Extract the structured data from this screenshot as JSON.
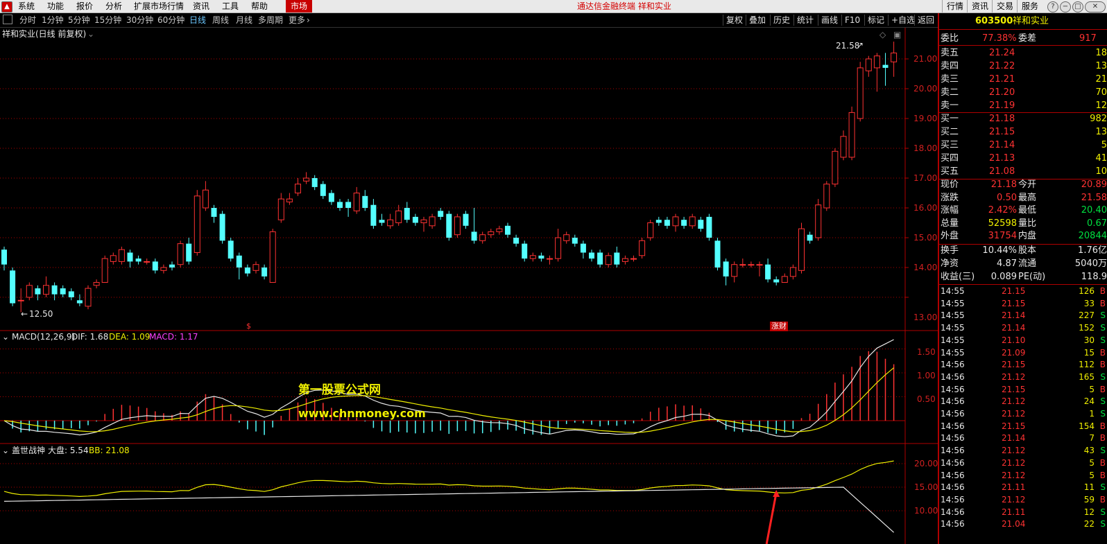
{
  "menu": {
    "items": [
      "系统",
      "功能",
      "报价",
      "分析",
      "扩展市场行情",
      "资讯",
      "工具",
      "帮助"
    ],
    "market_tab": "市场",
    "app_title": "通达信金融终端  祥和实业",
    "right_items": [
      "行情",
      "资讯",
      "交易",
      "服务"
    ]
  },
  "toolbar": {
    "periods": [
      "分时",
      "1分钟",
      "5分钟",
      "15分钟",
      "30分钟",
      "60分钟",
      "日线",
      "周线",
      "月线",
      "多周期",
      "更多"
    ],
    "active_period": "日线",
    "tools": [
      "复权",
      "叠加",
      "历史",
      "统计",
      "画线",
      "F10",
      "标记",
      "+自选",
      "返回"
    ]
  },
  "chart": {
    "main_title": "祥和实业(日线 前复权)",
    "high_label": "21.58",
    "low_label": "12.50",
    "price_axis": [
      "21.00",
      "20.00",
      "19.00",
      "18.00",
      "17.00",
      "16.00",
      "15.00",
      "14.00",
      "13.00"
    ],
    "event_markers": [
      "$",
      "涨财"
    ],
    "candles": [
      {
        "o": 14.6,
        "c": 14.1,
        "h": 14.7,
        "l": 13.9
      },
      {
        "o": 13.9,
        "c": 12.8,
        "h": 14.0,
        "l": 12.7
      },
      {
        "o": 12.9,
        "c": 12.9,
        "h": 13.3,
        "l": 12.5
      },
      {
        "o": 13.0,
        "c": 13.4,
        "h": 13.5,
        "l": 12.9
      },
      {
        "o": 13.3,
        "c": 13.1,
        "h": 13.4,
        "l": 12.9
      },
      {
        "o": 13.1,
        "c": 13.4,
        "h": 13.7,
        "l": 13.0
      },
      {
        "o": 13.4,
        "c": 13.1,
        "h": 13.5,
        "l": 12.9
      },
      {
        "o": 13.3,
        "c": 13.1,
        "h": 13.4,
        "l": 13.0
      },
      {
        "o": 13.2,
        "c": 13.0,
        "h": 13.3,
        "l": 12.9
      },
      {
        "o": 12.9,
        "c": 12.8,
        "h": 13.1,
        "l": 12.7
      },
      {
        "o": 12.7,
        "c": 13.3,
        "h": 13.4,
        "l": 12.6
      },
      {
        "o": 13.4,
        "c": 13.5,
        "h": 13.6,
        "l": 13.3
      },
      {
        "o": 13.5,
        "c": 14.3,
        "h": 14.4,
        "l": 13.5
      },
      {
        "o": 14.2,
        "c": 14.4,
        "h": 14.5,
        "l": 14.1
      },
      {
        "o": 14.2,
        "c": 14.6,
        "h": 14.7,
        "l": 14.1
      },
      {
        "o": 14.5,
        "c": 14.2,
        "h": 14.6,
        "l": 14.0
      },
      {
        "o": 14.3,
        "c": 14.2,
        "h": 14.4,
        "l": 14.1
      },
      {
        "o": 14.2,
        "c": 14.2,
        "h": 14.3,
        "l": 14.1
      },
      {
        "o": 14.2,
        "c": 13.9,
        "h": 14.3,
        "l": 13.8
      },
      {
        "o": 13.9,
        "c": 14.0,
        "h": 14.1,
        "l": 13.8
      },
      {
        "o": 14.1,
        "c": 14.0,
        "h": 14.2,
        "l": 13.9
      },
      {
        "o": 14.1,
        "c": 14.8,
        "h": 14.9,
        "l": 14.0
      },
      {
        "o": 14.8,
        "c": 14.2,
        "h": 15.0,
        "l": 14.1
      },
      {
        "o": 14.5,
        "c": 16.4,
        "h": 16.6,
        "l": 14.4
      },
      {
        "o": 16.0,
        "c": 16.6,
        "h": 16.9,
        "l": 15.9
      },
      {
        "o": 16.0,
        "c": 15.7,
        "h": 16.1,
        "l": 15.5
      },
      {
        "o": 15.8,
        "c": 14.9,
        "h": 15.9,
        "l": 14.8
      },
      {
        "o": 14.9,
        "c": 14.3,
        "h": 15.0,
        "l": 14.2
      },
      {
        "o": 14.4,
        "c": 14.0,
        "h": 14.5,
        "l": 13.6
      },
      {
        "o": 14.0,
        "c": 13.8,
        "h": 14.1,
        "l": 13.7
      },
      {
        "o": 13.9,
        "c": 14.1,
        "h": 14.2,
        "l": 13.8
      },
      {
        "o": 14.0,
        "c": 13.7,
        "h": 14.1,
        "l": 13.6
      },
      {
        "o": 13.5,
        "c": 15.2,
        "h": 15.3,
        "l": 13.5
      },
      {
        "o": 15.6,
        "c": 16.3,
        "h": 16.5,
        "l": 15.5
      },
      {
        "o": 16.2,
        "c": 16.3,
        "h": 16.5,
        "l": 16.1
      },
      {
        "o": 16.5,
        "c": 16.8,
        "h": 17.0,
        "l": 16.4
      },
      {
        "o": 16.9,
        "c": 17.0,
        "h": 17.2,
        "l": 16.8
      },
      {
        "o": 17.0,
        "c": 16.7,
        "h": 17.1,
        "l": 16.6
      },
      {
        "o": 16.8,
        "c": 16.4,
        "h": 16.9,
        "l": 16.3
      },
      {
        "o": 16.5,
        "c": 16.2,
        "h": 16.6,
        "l": 16.1
      },
      {
        "o": 16.2,
        "c": 16.0,
        "h": 16.3,
        "l": 15.9
      },
      {
        "o": 16.2,
        "c": 16.0,
        "h": 16.3,
        "l": 15.7
      },
      {
        "o": 15.9,
        "c": 16.5,
        "h": 16.7,
        "l": 15.8
      },
      {
        "o": 16.4,
        "c": 16.0,
        "h": 16.6,
        "l": 15.9
      },
      {
        "o": 16.1,
        "c": 15.4,
        "h": 16.3,
        "l": 15.3
      },
      {
        "o": 15.6,
        "c": 15.5,
        "h": 15.8,
        "l": 15.4
      },
      {
        "o": 15.4,
        "c": 15.6,
        "h": 15.8,
        "l": 15.3
      },
      {
        "o": 15.5,
        "c": 15.9,
        "h": 16.1,
        "l": 15.4
      },
      {
        "o": 16.0,
        "c": 15.6,
        "h": 16.2,
        "l": 15.5
      },
      {
        "o": 15.7,
        "c": 15.5,
        "h": 15.8,
        "l": 15.4
      },
      {
        "o": 15.5,
        "c": 15.6,
        "h": 15.7,
        "l": 15.2
      },
      {
        "o": 15.4,
        "c": 15.7,
        "h": 15.8,
        "l": 15.3
      },
      {
        "o": 15.9,
        "c": 15.7,
        "h": 16.0,
        "l": 15.6
      },
      {
        "o": 15.8,
        "c": 15.0,
        "h": 15.9,
        "l": 14.9
      },
      {
        "o": 15.1,
        "c": 15.7,
        "h": 15.8,
        "l": 15.0
      },
      {
        "o": 15.8,
        "c": 15.4,
        "h": 15.9,
        "l": 15.3
      },
      {
        "o": 15.2,
        "c": 14.9,
        "h": 16.0,
        "l": 14.8
      },
      {
        "o": 14.9,
        "c": 15.1,
        "h": 15.2,
        "l": 14.8
      },
      {
        "o": 15.1,
        "c": 15.2,
        "h": 15.3,
        "l": 15.0
      },
      {
        "o": 15.2,
        "c": 15.3,
        "h": 15.4,
        "l": 15.1
      },
      {
        "o": 15.4,
        "c": 15.1,
        "h": 15.5,
        "l": 15.0
      },
      {
        "o": 15.0,
        "c": 14.8,
        "h": 15.1,
        "l": 14.7
      },
      {
        "o": 14.8,
        "c": 14.3,
        "h": 14.9,
        "l": 14.2
      },
      {
        "o": 14.3,
        "c": 14.4,
        "h": 14.5,
        "l": 14.2
      },
      {
        "o": 14.4,
        "c": 14.3,
        "h": 14.5,
        "l": 14.2
      },
      {
        "o": 14.3,
        "c": 14.3,
        "h": 14.4,
        "l": 14.1
      },
      {
        "o": 14.3,
        "c": 15.0,
        "h": 15.3,
        "l": 14.2
      },
      {
        "o": 14.9,
        "c": 15.1,
        "h": 15.2,
        "l": 14.8
      },
      {
        "o": 15.0,
        "c": 14.8,
        "h": 15.1,
        "l": 14.7
      },
      {
        "o": 14.8,
        "c": 14.5,
        "h": 14.9,
        "l": 14.3
      },
      {
        "o": 14.5,
        "c": 14.3,
        "h": 14.6,
        "l": 14.2
      },
      {
        "o": 14.5,
        "c": 14.1,
        "h": 14.6,
        "l": 14.0
      },
      {
        "o": 14.1,
        "c": 14.4,
        "h": 14.5,
        "l": 14.0
      },
      {
        "o": 14.5,
        "c": 14.1,
        "h": 14.7,
        "l": 14.0
      },
      {
        "o": 14.2,
        "c": 14.3,
        "h": 14.4,
        "l": 14.1
      },
      {
        "o": 14.3,
        "c": 14.3,
        "h": 14.4,
        "l": 14.2
      },
      {
        "o": 14.4,
        "c": 14.9,
        "h": 15.0,
        "l": 14.3
      },
      {
        "o": 15.0,
        "c": 15.5,
        "h": 15.6,
        "l": 14.9
      },
      {
        "o": 15.6,
        "c": 15.5,
        "h": 15.7,
        "l": 15.4
      },
      {
        "o": 15.6,
        "c": 15.4,
        "h": 15.7,
        "l": 15.3
      },
      {
        "o": 15.4,
        "c": 15.7,
        "h": 15.8,
        "l": 15.2
      },
      {
        "o": 15.6,
        "c": 15.4,
        "h": 15.7,
        "l": 15.3
      },
      {
        "o": 15.4,
        "c": 15.7,
        "h": 15.8,
        "l": 15.3
      },
      {
        "o": 15.6,
        "c": 15.3,
        "h": 15.7,
        "l": 15.2
      },
      {
        "o": 15.7,
        "c": 15.0,
        "h": 15.8,
        "l": 14.9
      },
      {
        "o": 14.9,
        "c": 14.0,
        "h": 15.0,
        "l": 13.9
      },
      {
        "o": 14.2,
        "c": 13.7,
        "h": 14.3,
        "l": 13.4
      },
      {
        "o": 13.7,
        "c": 14.1,
        "h": 14.2,
        "l": 13.5
      },
      {
        "o": 14.1,
        "c": 14.1,
        "h": 14.3,
        "l": 14.0
      },
      {
        "o": 14.1,
        "c": 14.1,
        "h": 14.2,
        "l": 14.0
      },
      {
        "o": 14.1,
        "c": 14.1,
        "h": 14.2,
        "l": 13.7
      },
      {
        "o": 14.1,
        "c": 13.6,
        "h": 14.3,
        "l": 13.5
      },
      {
        "o": 13.6,
        "c": 13.5,
        "h": 13.7,
        "l": 13.4
      },
      {
        "o": 13.5,
        "c": 13.7,
        "h": 13.8,
        "l": 13.5
      },
      {
        "o": 13.7,
        "c": 14.0,
        "h": 14.1,
        "l": 13.6
      },
      {
        "o": 13.9,
        "c": 15.3,
        "h": 15.5,
        "l": 13.8
      },
      {
        "o": 15.1,
        "c": 14.9,
        "h": 15.2,
        "l": 14.8
      },
      {
        "o": 15.0,
        "c": 16.1,
        "h": 16.3,
        "l": 14.9
      },
      {
        "o": 16.0,
        "c": 16.8,
        "h": 16.9,
        "l": 15.9
      },
      {
        "o": 16.8,
        "c": 17.9,
        "h": 18.0,
        "l": 16.7
      },
      {
        "o": 17.7,
        "c": 18.4,
        "h": 18.6,
        "l": 17.6
      },
      {
        "o": 17.7,
        "c": 19.2,
        "h": 19.4,
        "l": 17.6
      },
      {
        "o": 19.0,
        "c": 20.7,
        "h": 20.9,
        "l": 18.9
      },
      {
        "o": 20.6,
        "c": 21.0,
        "h": 21.1,
        "l": 20.4
      },
      {
        "o": 20.7,
        "c": 21.1,
        "h": 21.2,
        "l": 19.9
      },
      {
        "o": 20.8,
        "c": 20.7,
        "h": 21.2,
        "l": 20.1
      },
      {
        "o": 20.9,
        "c": 21.2,
        "h": 21.58,
        "l": 20.4
      }
    ],
    "macd": {
      "title": "MACD(12,26,9)",
      "dif_label": "DIF: 1.68",
      "dea_label": "DEA: 1.09",
      "macd_label": "MACD: 1.17",
      "axis": [
        "1.50",
        "1.00",
        "0.50"
      ]
    },
    "ind2": {
      "title": "盖世战神",
      "dapan_label": "大盘: 5.54",
      "bb_label": "BB: 21.08",
      "axis": [
        "20.00",
        "15.00",
        "10.00"
      ]
    },
    "watermark_line1": "第一股票公式网",
    "watermark_line2": "www.chnmoney.com"
  },
  "quote": {
    "code": "603500",
    "name": "祥和实业",
    "weibi_label": "委比",
    "weibi_value": "77.38%",
    "weicha_label": "委差",
    "weicha_value": "917",
    "sells": [
      {
        "label": "卖五",
        "price": "21.24",
        "vol": "18"
      },
      {
        "label": "卖四",
        "price": "21.22",
        "vol": "13"
      },
      {
        "label": "卖三",
        "price": "21.21",
        "vol": "21"
      },
      {
        "label": "卖二",
        "price": "21.20",
        "vol": "70"
      },
      {
        "label": "卖一",
        "price": "21.19",
        "vol": "12"
      }
    ],
    "buys": [
      {
        "label": "买一",
        "price": "21.18",
        "vol": "982"
      },
      {
        "label": "买二",
        "price": "21.15",
        "vol": "13"
      },
      {
        "label": "买三",
        "price": "21.14",
        "vol": "5"
      },
      {
        "label": "买四",
        "price": "21.13",
        "vol": "41"
      },
      {
        "label": "买五",
        "price": "21.08",
        "vol": "10"
      }
    ],
    "stats": [
      {
        "l1": "现价",
        "v1": "21.18",
        "c1": "red",
        "l2": "今开",
        "v2": "20.89",
        "c2": "red"
      },
      {
        "l1": "涨跌",
        "v1": "0.50",
        "c1": "red",
        "l2": "最高",
        "v2": "21.58",
        "c2": "red"
      },
      {
        "l1": "涨幅",
        "v1": "2.42%",
        "c1": "red",
        "l2": "最低",
        "v2": "20.40",
        "c2": "green"
      },
      {
        "l1": "总量",
        "v1": "52598",
        "c1": "yellow",
        "l2": "量比",
        "v2": "0.67",
        "c2": "green"
      },
      {
        "l1": "外盘",
        "v1": "31754",
        "c1": "red",
        "l2": "内盘",
        "v2": "20844",
        "c2": "green"
      }
    ],
    "stats2": [
      {
        "l1": "换手",
        "v1": "10.44%",
        "l2": "股本",
        "v2": "1.76亿"
      },
      {
        "l1": "净资",
        "v1": "4.87",
        "l2": "流通",
        "v2": "5040万"
      },
      {
        "l1": "收益(三)",
        "v1": "0.089",
        "l2": "PE(动)",
        "v2": "118.9"
      }
    ],
    "ticks": [
      {
        "t": "14:55",
        "p": "21.15",
        "v": "126",
        "s": "B"
      },
      {
        "t": "14:55",
        "p": "21.15",
        "v": "33",
        "s": "B"
      },
      {
        "t": "14:55",
        "p": "21.14",
        "v": "227",
        "s": "S"
      },
      {
        "t": "14:55",
        "p": "21.14",
        "v": "152",
        "s": "S"
      },
      {
        "t": "14:55",
        "p": "21.10",
        "v": "30",
        "s": "S"
      },
      {
        "t": "14:55",
        "p": "21.09",
        "v": "15",
        "s": "B"
      },
      {
        "t": "14:56",
        "p": "21.15",
        "v": "112",
        "s": "B"
      },
      {
        "t": "14:56",
        "p": "21.12",
        "v": "165",
        "s": "S"
      },
      {
        "t": "14:56",
        "p": "21.15",
        "v": "5",
        "s": "B"
      },
      {
        "t": "14:56",
        "p": "21.12",
        "v": "24",
        "s": "S"
      },
      {
        "t": "14:56",
        "p": "21.12",
        "v": "1",
        "s": "S"
      },
      {
        "t": "14:56",
        "p": "21.15",
        "v": "154",
        "s": "B"
      },
      {
        "t": "14:56",
        "p": "21.14",
        "v": "7",
        "s": "B"
      },
      {
        "t": "14:56",
        "p": "21.12",
        "v": "43",
        "s": "S"
      },
      {
        "t": "14:56",
        "p": "21.12",
        "v": "5",
        "s": "B"
      },
      {
        "t": "14:56",
        "p": "21.12",
        "v": "5",
        "s": "B"
      },
      {
        "t": "14:56",
        "p": "21.11",
        "v": "11",
        "s": "S"
      },
      {
        "t": "14:56",
        "p": "21.12",
        "v": "59",
        "s": "B"
      },
      {
        "t": "14:56",
        "p": "21.11",
        "v": "12",
        "s": "S"
      },
      {
        "t": "14:56",
        "p": "21.04",
        "v": "22",
        "s": "S"
      }
    ]
  },
  "colors": {
    "up": "#ff3232",
    "down": "#54ffff",
    "grid": "#b00000",
    "dif": "#e8e8e8",
    "dea": "#f0f000"
  }
}
